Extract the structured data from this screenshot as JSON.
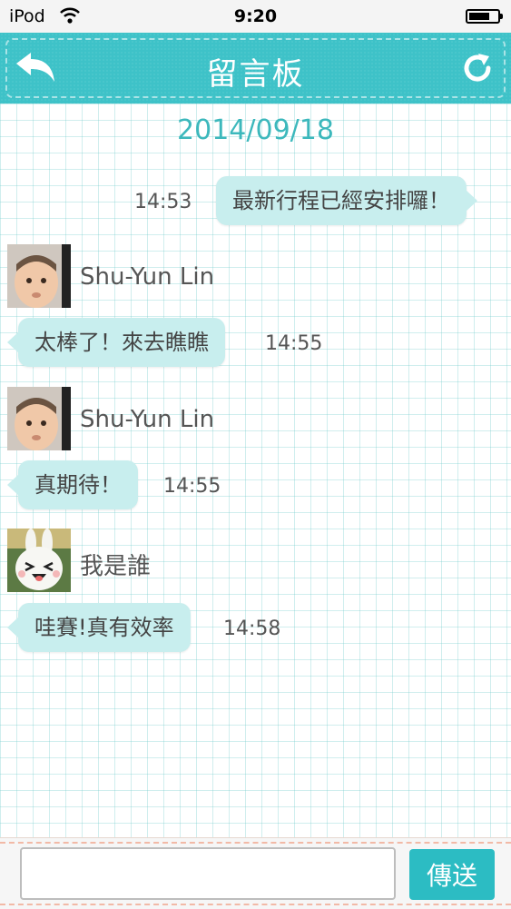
{
  "status_bar": {
    "carrier": "iPod",
    "time": "9:20"
  },
  "nav": {
    "title": "留言板",
    "back_icon": "back-arrow-icon",
    "refresh_icon": "refresh-icon",
    "accent_color": "#3ec2c8"
  },
  "date_header": "2014/09/18",
  "messages": [
    {
      "side": "right",
      "sender": "",
      "text": "最新行程已經安排囉！",
      "time": "14:53"
    },
    {
      "side": "left",
      "sender": "Shu-Yun Lin",
      "avatar": "baby-photo",
      "text": "太棒了！來去瞧瞧",
      "time": "14:55"
    },
    {
      "side": "left",
      "sender": "Shu-Yun Lin",
      "avatar": "baby-photo",
      "text": "真期待！",
      "time": "14:55"
    },
    {
      "side": "left",
      "sender": "我是誰",
      "avatar": "bunny-photo",
      "text": "哇賽!真有效率",
      "time": "14:58"
    }
  ],
  "input": {
    "value": "",
    "send_label": "傳送"
  }
}
